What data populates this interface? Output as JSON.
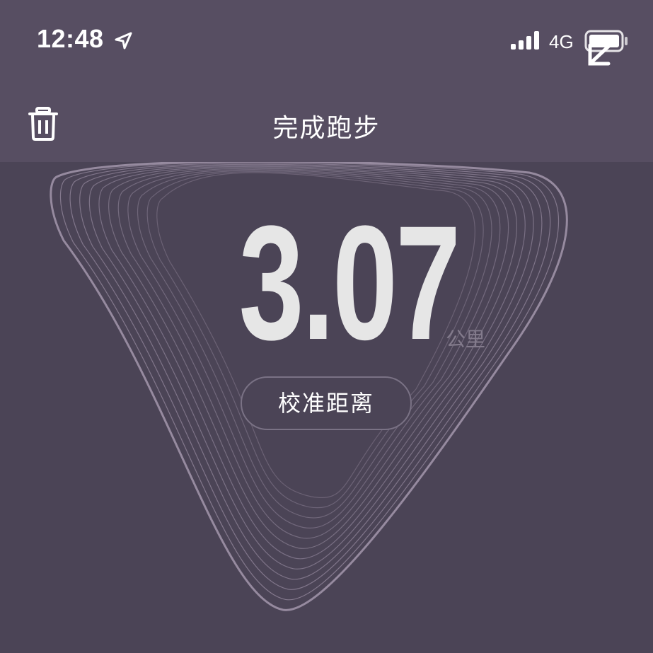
{
  "status_bar": {
    "time": "12:48",
    "network": "4G",
    "location_icon": "location-arrow-icon",
    "signal_icon": "signal-bars-icon",
    "battery_icon": "battery-icon"
  },
  "header": {
    "title": "完成跑步",
    "delete_icon": "trash-icon"
  },
  "main": {
    "distance_value": "3.07",
    "distance_unit": "公里",
    "calibrate_button": "校准距离"
  },
  "colors": {
    "header_bg": "#574e62",
    "body_bg": "#4b4456",
    "shape_stroke": "#9a8ea3",
    "distance_text": "#e6e6e6",
    "unit_text": "#837b8c"
  }
}
